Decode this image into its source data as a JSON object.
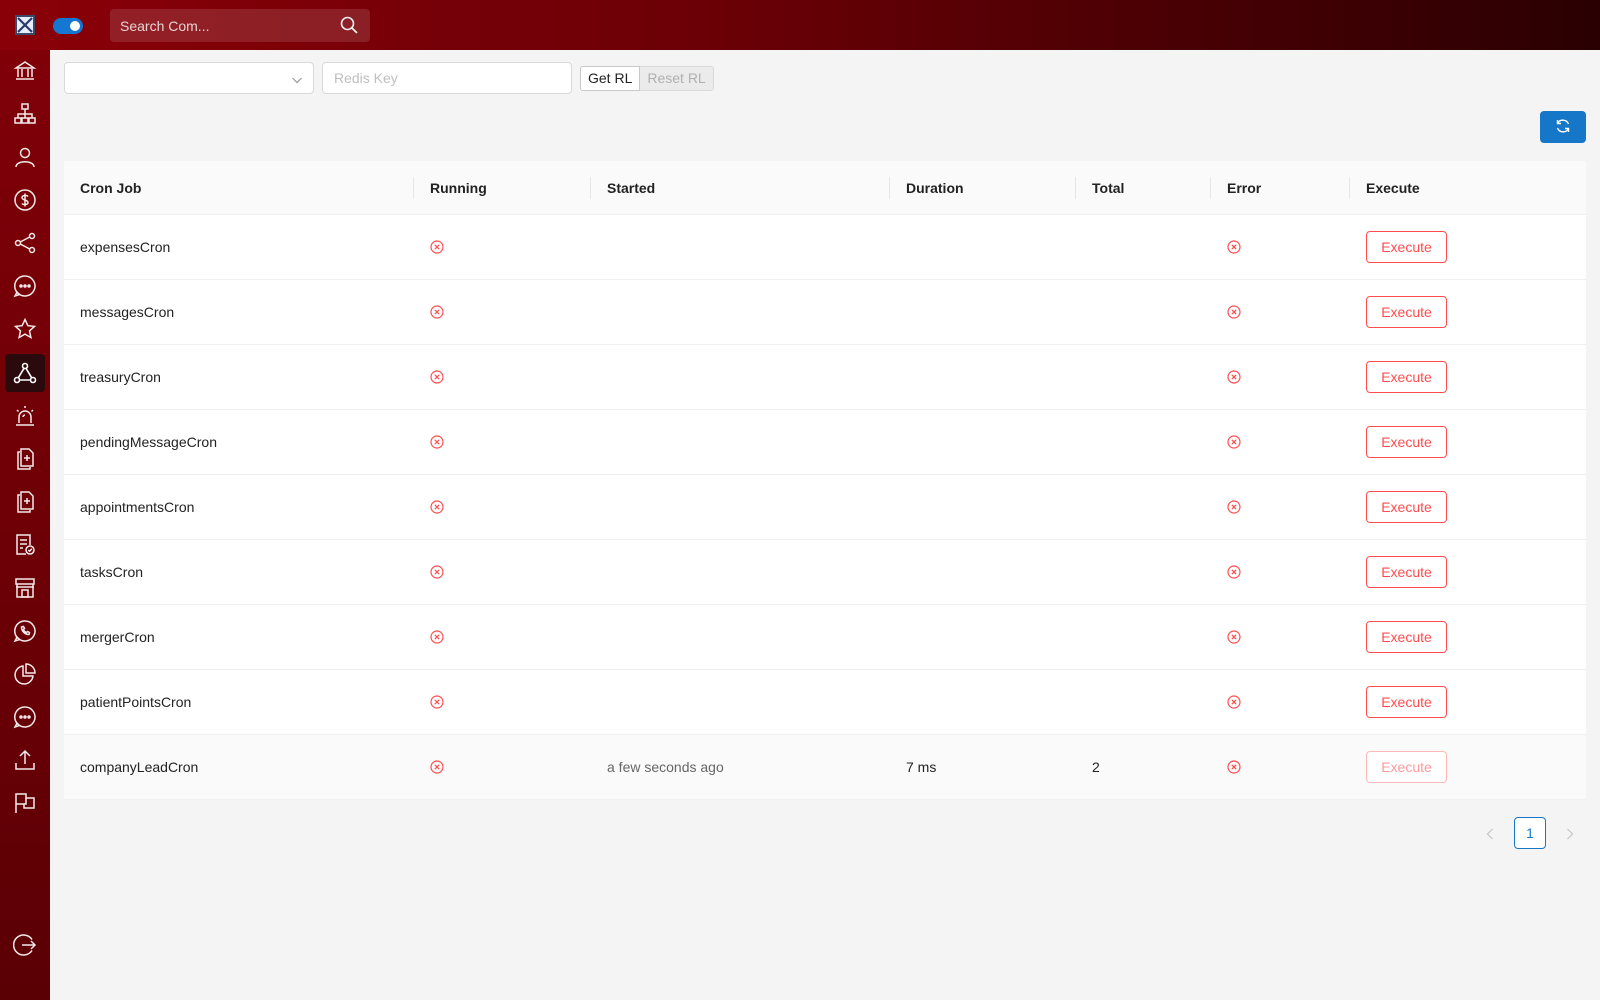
{
  "topbar": {
    "search_placeholder": "Search Com..."
  },
  "sidebar": {
    "icons": [
      "bank-icon",
      "org-chart-icon",
      "user-icon",
      "dollar-icon",
      "share-icon",
      "chat-icon",
      "star-icon",
      "network-icon",
      "alarm-icon",
      "document-plus-icon",
      "document-plus-icon",
      "document-check-icon",
      "store-icon",
      "phone-icon",
      "pie-chart-icon",
      "chat-icon",
      "upload-icon",
      "flag-icon",
      "logout-icon"
    ],
    "active_icon": "network-icon"
  },
  "controls": {
    "redis_key_placeholder": "Redis Key",
    "get_rl_label": "Get RL",
    "reset_rl_label": "Reset RL"
  },
  "table": {
    "columns": [
      "Cron Job",
      "Running",
      "Started",
      "Duration",
      "Total",
      "Error",
      "Execute"
    ],
    "rows": [
      {
        "name": "expensesCron",
        "started": "",
        "duration": "",
        "total": "",
        "execute_label": "Execute"
      },
      {
        "name": "messagesCron",
        "started": "",
        "duration": "",
        "total": "",
        "execute_label": "Execute"
      },
      {
        "name": "treasuryCron",
        "started": "",
        "duration": "",
        "total": "",
        "execute_label": "Execute"
      },
      {
        "name": "pendingMessageCron",
        "started": "",
        "duration": "",
        "total": "",
        "execute_label": "Execute"
      },
      {
        "name": "appointmentsCron",
        "started": "",
        "duration": "",
        "total": "",
        "execute_label": "Execute"
      },
      {
        "name": "tasksCron",
        "started": "",
        "duration": "",
        "total": "",
        "execute_label": "Execute"
      },
      {
        "name": "mergerCron",
        "started": "",
        "duration": "",
        "total": "",
        "execute_label": "Execute"
      },
      {
        "name": "patientPointsCron",
        "started": "",
        "duration": "",
        "total": "",
        "execute_label": "Execute"
      },
      {
        "name": "companyLeadCron",
        "started": "a few seconds ago",
        "duration": "7 ms",
        "total": "2",
        "execute_label": "Execute"
      }
    ]
  },
  "pagination": {
    "current_page": "1"
  },
  "colors": {
    "brand_red": "#8a0008",
    "accent_blue": "#1677c9",
    "error_red": "#ff4d4f"
  }
}
